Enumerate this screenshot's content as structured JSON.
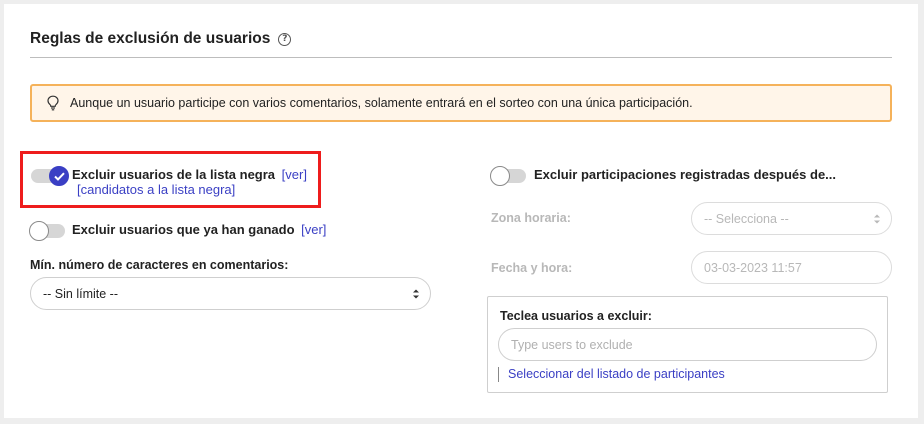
{
  "section": {
    "title": "Reglas de exclusión de usuarios",
    "help_icon": "?"
  },
  "alert": {
    "icon": "lightbulb-icon",
    "text": "Aunque un usuario participe con varios comentarios, solamente entrará en el sorteo con una única participación."
  },
  "left": {
    "blacklist": {
      "label": "Excluir usuarios de la lista negra",
      "enabled": true,
      "link_ver": "[ver]",
      "link_candidates": "[candidatos a la lista negra]"
    },
    "previous_winners": {
      "label": "Excluir usuarios que ya han ganado",
      "enabled": false,
      "link_ver": "[ver]"
    },
    "min_chars": {
      "label": "Mín. número de caracteres en comentarios:",
      "value": "-- Sin límite --"
    }
  },
  "right": {
    "after_date": {
      "label": "Excluir participaciones registradas después de...",
      "enabled": false
    },
    "timezone": {
      "label": "Zona horaria:",
      "value": "-- Selecciona --"
    },
    "datetime": {
      "label": "Fecha y hora:",
      "value": "03-03-2023 11:57"
    },
    "exclude_users": {
      "title": "Teclea usuarios a excluir:",
      "placeholder": "Type users to exclude",
      "link": "Seleccionar del listado de participantes"
    }
  },
  "colors": {
    "accent": "#3a3fc4",
    "alert_border": "#f5b25a",
    "alert_bg": "#fff5e9",
    "highlight": "#ee1c1c"
  }
}
